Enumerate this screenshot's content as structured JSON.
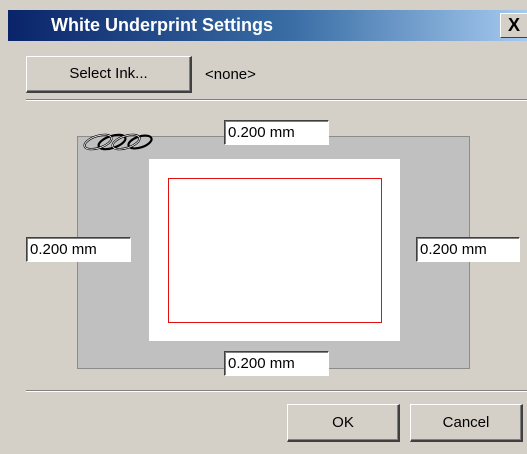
{
  "window": {
    "title": "White Underprint Settings",
    "close_label": "X"
  },
  "ink": {
    "select_button_label": "Select Ink...",
    "current_value": "<none>"
  },
  "margins": {
    "top": "0.200 mm",
    "left": "0.200 mm",
    "right": "0.200 mm",
    "bottom": "0.200 mm"
  },
  "buttons": {
    "ok_label": "OK",
    "cancel_label": "Cancel"
  },
  "icons": {
    "link": "chain-link-icon",
    "close": "close-icon"
  },
  "colors": {
    "title_bar_start": "#0a246a",
    "title_bar_end": "#a6caf0",
    "margin_outline": "#e01010",
    "face": "#d4d0c8"
  }
}
